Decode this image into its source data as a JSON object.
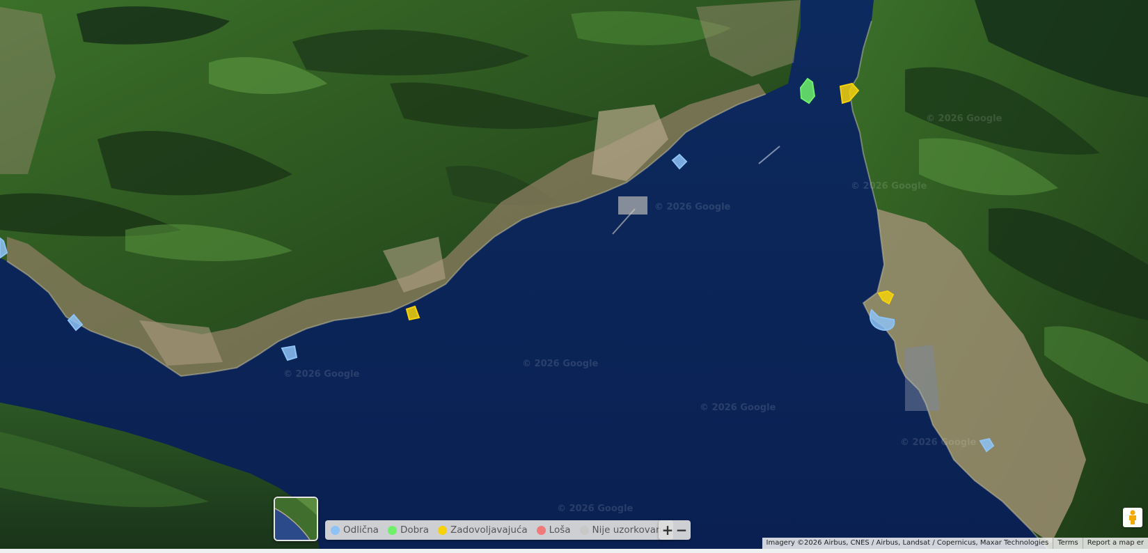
{
  "map": {
    "type": "satellite",
    "watermark_text": "© 2026 Google",
    "colors": {
      "water": "#0c2556",
      "land_dark": "#1d3a1a",
      "land_green": "#3f7a2e",
      "town": "#b8a48a"
    }
  },
  "beaches": [
    {
      "id": "b1",
      "quality": "dobra"
    },
    {
      "id": "b2",
      "quality": "zadovoljavajuca"
    },
    {
      "id": "b3",
      "quality": "odlicna"
    },
    {
      "id": "b4",
      "quality": "zadovoljavajuca"
    },
    {
      "id": "b5",
      "quality": "odlicna"
    },
    {
      "id": "b6",
      "quality": "odlicna"
    },
    {
      "id": "b7",
      "quality": "zadovoljavajuca"
    },
    {
      "id": "b8",
      "quality": "odlicna"
    },
    {
      "id": "b9",
      "quality": "odlicna"
    },
    {
      "id": "b10",
      "quality": "odlicna"
    }
  ],
  "legend": {
    "items": [
      {
        "key": "odlicna",
        "label": "Odlična",
        "color": "#8ec2f5"
      },
      {
        "key": "dobra",
        "label": "Dobra",
        "color": "#6ff06a"
      },
      {
        "key": "zadovoljavajuca",
        "label": "Zadovoljavajuća",
        "color": "#f5d20a"
      },
      {
        "key": "losa",
        "label": "Loša",
        "color": "#f07a7a"
      },
      {
        "key": "nije",
        "label": "Nije uzorkovano",
        "color": "#c8c8c8"
      }
    ]
  },
  "zoom": {
    "in_label": "+",
    "out_label": "−"
  },
  "attribution": {
    "imagery": "Imagery ©2026 Airbus, CNES / Airbus, Landsat / Copernicus, Maxar Technologies",
    "terms": "Terms",
    "report": "Report a map er"
  },
  "icons": {
    "minimap": "map-type-thumbnail-icon",
    "pegman": "street-view-pegman-icon"
  }
}
